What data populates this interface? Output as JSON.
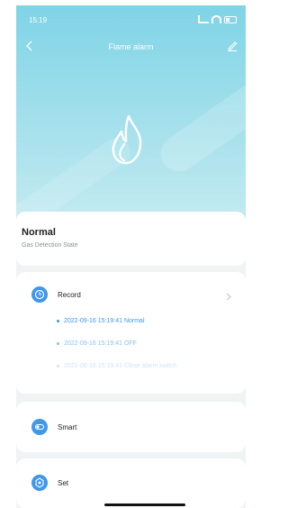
{
  "status_bar": {
    "time": "15:19"
  },
  "header": {
    "title": "Flame alarm",
    "back_icon": "chevron-left-icon",
    "edit_icon": "pencil-icon"
  },
  "state": {
    "value": "Normal",
    "label": "Gas Detection State"
  },
  "record": {
    "label": "Record",
    "icon": "clock-icon",
    "entries": [
      {
        "text": "2022-09-16 15:19:41 Normal",
        "color": "#3f97ea"
      },
      {
        "text": "2022-09-16 15:19:41 OFF",
        "color": "#8cc0f1"
      },
      {
        "text": "2022-09-16 15:19:41 Close alarm switch",
        "color": "#cfe4f8"
      }
    ]
  },
  "smart": {
    "label": "Smart",
    "icon": "toggle-icon"
  },
  "set": {
    "label": "Set",
    "icon": "gear-icon"
  },
  "colors": {
    "accent": "#3f97ea",
    "header_top": "#7fd4e6",
    "background": "#f0f3f4"
  }
}
